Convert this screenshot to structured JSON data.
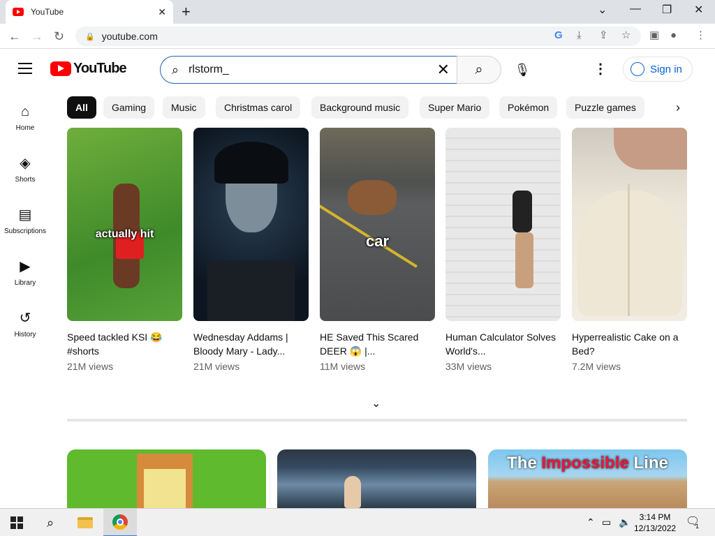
{
  "browser": {
    "tab_title": "YouTube",
    "url": "youtube.com"
  },
  "header": {
    "logo_text": "YouTube",
    "search_value": "rlstorm_",
    "signin_label": "Sign in"
  },
  "sidebar": {
    "items": [
      {
        "label": "Home",
        "icon": "home-icon"
      },
      {
        "label": "Shorts",
        "icon": "shorts-icon"
      },
      {
        "label": "Subscriptions",
        "icon": "subscriptions-icon"
      },
      {
        "label": "Library",
        "icon": "library-icon"
      },
      {
        "label": "History",
        "icon": "history-icon"
      }
    ]
  },
  "chips": [
    "All",
    "Gaming",
    "Music",
    "Christmas carol",
    "Background music",
    "Super Mario",
    "Pokémon",
    "Puzzle games"
  ],
  "shorts": [
    {
      "title": "Speed tackled KSI 😂 #shorts",
      "views": "21M views",
      "overlay": "actually hit"
    },
    {
      "title": "Wednesday Addams | Bloody Mary - Lady...",
      "views": "21M views",
      "overlay": ""
    },
    {
      "title": "HE Saved This Scared DEER 😱 |...",
      "views": "11M views",
      "overlay": "car"
    },
    {
      "title": "Human Calculator Solves World's...",
      "views": "33M views",
      "overlay": ""
    },
    {
      "title": "Hyperrealistic Cake on a Bed?",
      "views": "7.2M views",
      "overlay": ""
    }
  ],
  "videos": [
    {
      "thumb_text": ""
    },
    {
      "thumb_text": ""
    },
    {
      "thumb_text_1": "The ",
      "thumb_text_2": "Impossible",
      "thumb_text_3": " Line"
    }
  ],
  "taskbar": {
    "time": "3:14 PM",
    "date": "12/13/2022",
    "notification_count": "1"
  }
}
